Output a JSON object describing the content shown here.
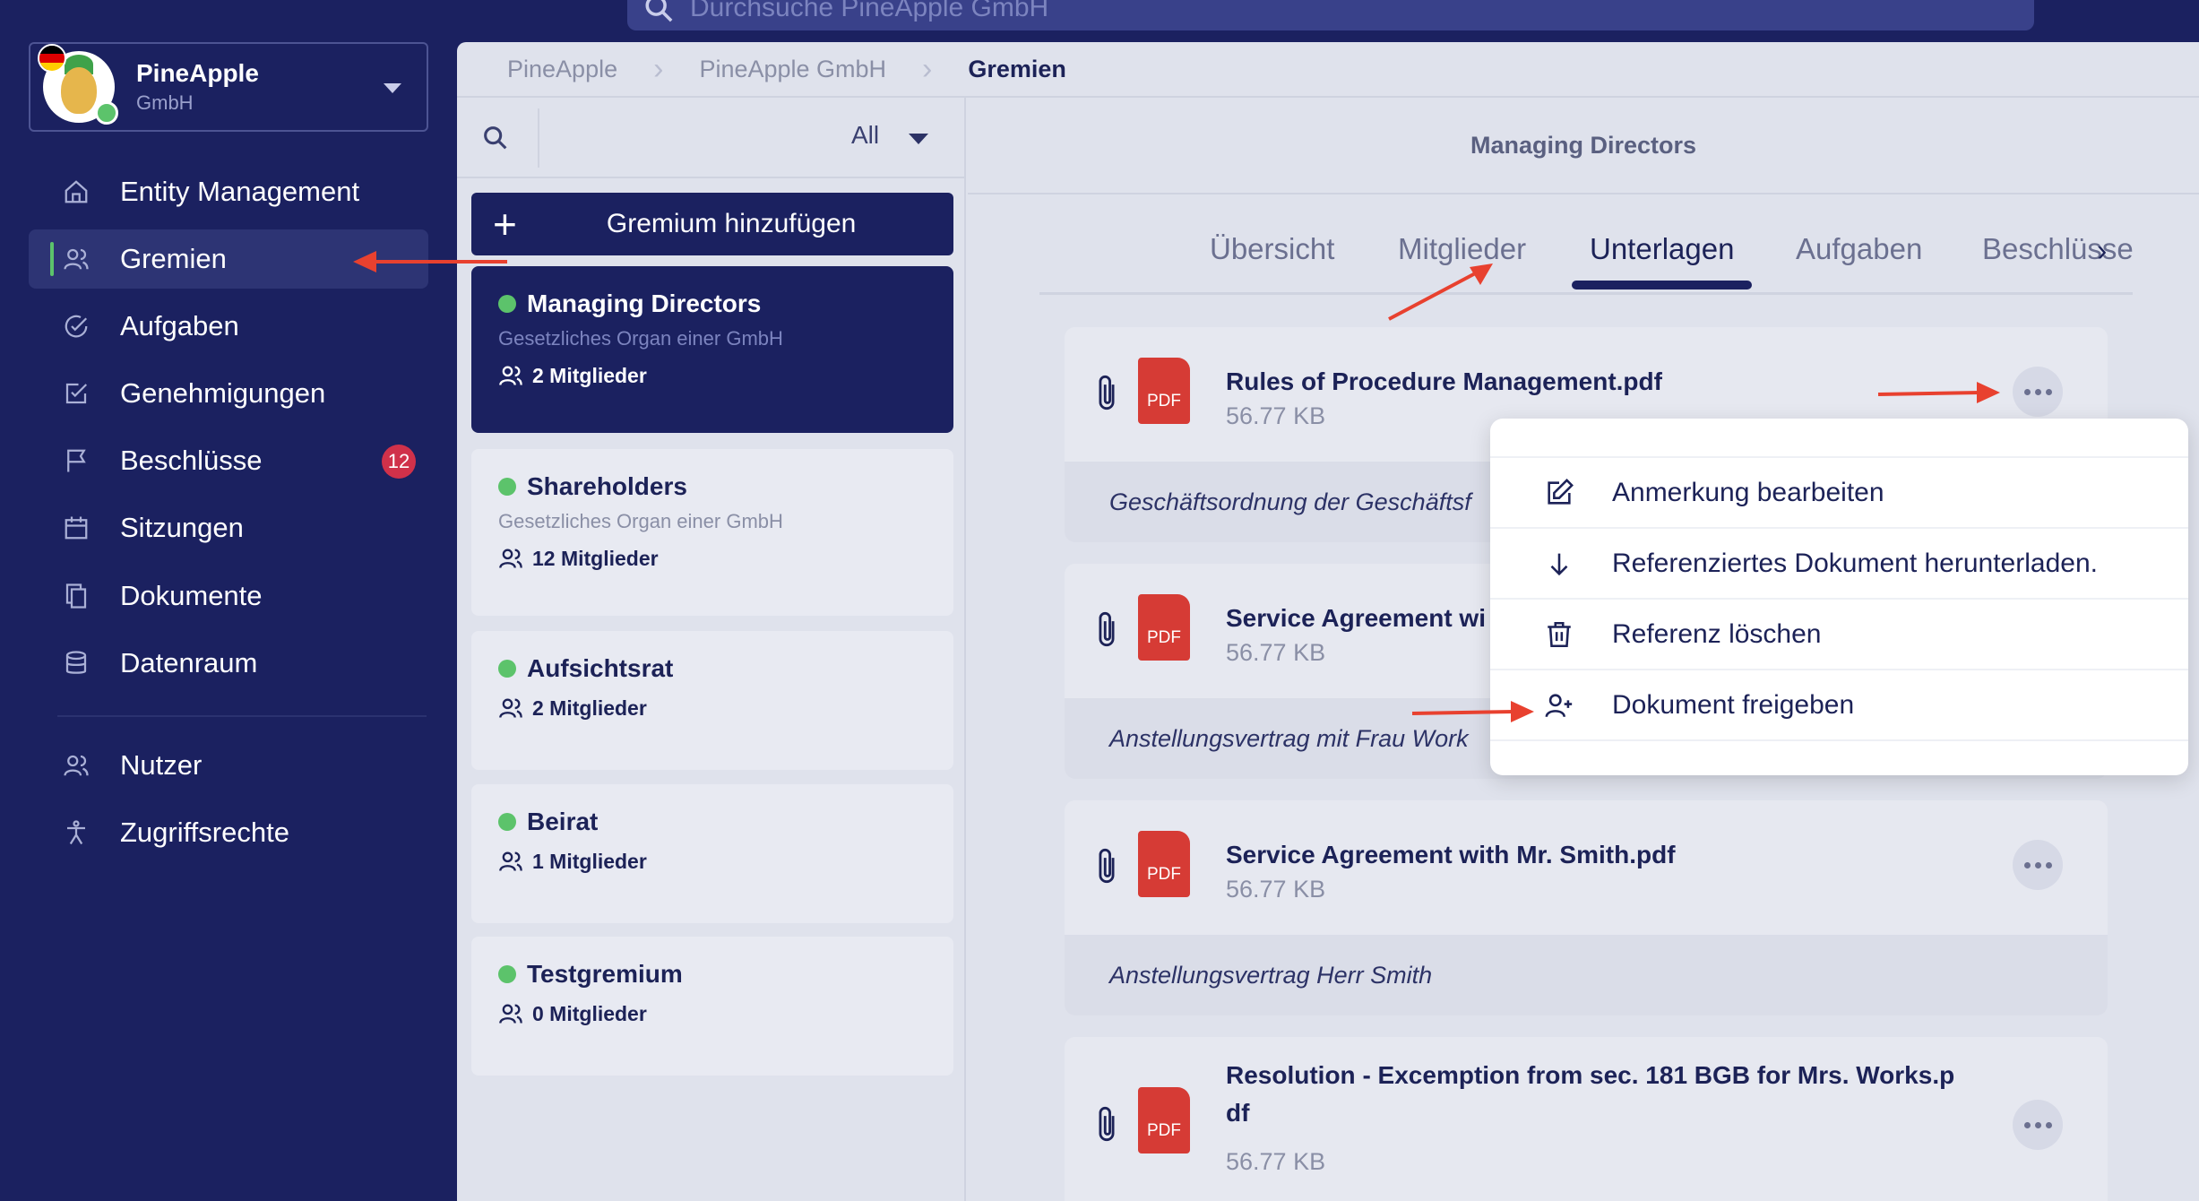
{
  "search": {
    "placeholder": "Durchsuche PineApple  GmbH"
  },
  "org": {
    "name": "PineApple",
    "sub": "GmbH"
  },
  "sidebar": {
    "items": [
      {
        "label": "Entity Management"
      },
      {
        "label": "Gremien"
      },
      {
        "label": "Aufgaben"
      },
      {
        "label": "Genehmigungen"
      },
      {
        "label": "Beschlüsse",
        "badge": "12"
      },
      {
        "label": "Sitzungen"
      },
      {
        "label": "Dokumente"
      },
      {
        "label": "Datenraum"
      },
      {
        "label": "Nutzer"
      },
      {
        "label": "Zugriffsrechte"
      }
    ]
  },
  "breadcrumb": {
    "c1": "PineApple",
    "c2": "PineApple GmbH",
    "c3": "Gremien"
  },
  "list": {
    "filter": "All",
    "add_label": "Gremium hinzufügen",
    "committees": [
      {
        "name": "Managing Directors",
        "desc": "Gesetzliches Organ einer GmbH",
        "members": "2 Mitglieder"
      },
      {
        "name": "Shareholders",
        "desc": "Gesetzliches Organ einer GmbH",
        "members": "12 Mitglieder"
      },
      {
        "name": "Aufsichtsrat",
        "members": "2 Mitglieder"
      },
      {
        "name": "Beirat",
        "members": "1 Mitglieder"
      },
      {
        "name": "Testgremium",
        "members": "0 Mitglieder"
      }
    ]
  },
  "detail": {
    "title": "Managing Directors",
    "tabs": [
      "Übersicht",
      "Mitglieder",
      "Unterlagen",
      "Aufgaben",
      "Beschlüsse"
    ],
    "more": "›",
    "documents": [
      {
        "name": "Rules of Procedure Management.pdf",
        "size": "56.77 KB",
        "note": "Geschäftsordnung der Geschäftsf"
      },
      {
        "name": "Service Agreement wi",
        "size": "56.77 KB",
        "note": "Anstellungsvertrag mit Frau Work"
      },
      {
        "name": "Service Agreement with Mr. Smith.pdf",
        "size": "56.77 KB",
        "note": "Anstellungsvertrag Herr Smith"
      },
      {
        "name": "Resolution - Excemption from sec. 181 BGB for Mrs. Works.p df",
        "size": "56.77 KB"
      }
    ],
    "pdf_label": "PDF"
  },
  "menu": {
    "items": [
      {
        "label": "Anmerkung bearbeiten"
      },
      {
        "label": "Referenziertes Dokument herunterladen."
      },
      {
        "label": "Referenz löschen"
      },
      {
        "label": "Dokument freigeben"
      }
    ]
  },
  "colors": {
    "sidebar": "#1b2160",
    "accent_green": "#5cc36b",
    "badge_red": "#d0314a",
    "pdf_red": "#d63b35",
    "annotation_arrow": "#e8412f"
  }
}
